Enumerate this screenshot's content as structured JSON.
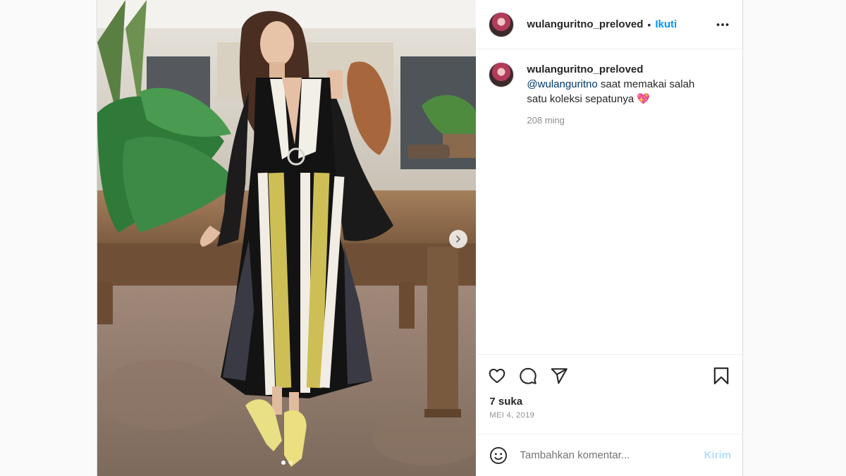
{
  "header": {
    "username": "wulanguritno_preloved",
    "separator": "•",
    "follow_label": "Ikuti",
    "more_icon": "more-horizontal-icon"
  },
  "caption": {
    "username": "wulanguritno_preloved",
    "mention": "@wulanguritno",
    "text": " saat memakai salah satu koleksi sepatunya ",
    "emoji": "💖",
    "time": "208 ming"
  },
  "actions": {
    "like_icon": "heart-icon",
    "comment_icon": "comment-icon",
    "share_icon": "send-icon",
    "save_icon": "bookmark-icon"
  },
  "likes": "7 suka",
  "date": "MEI 4, 2019",
  "comment_box": {
    "placeholder": "Tambahkan komentar...",
    "send_label": "Kirim",
    "emoji_icon": "smiley-icon"
  },
  "carousel": {
    "total_slides": 2,
    "current_slide": 1
  },
  "colors": {
    "link_blue": "#0095f6",
    "mention_blue": "#00376b",
    "muted_gray": "#8e8e8e",
    "send_disabled": "#b2dffc"
  }
}
